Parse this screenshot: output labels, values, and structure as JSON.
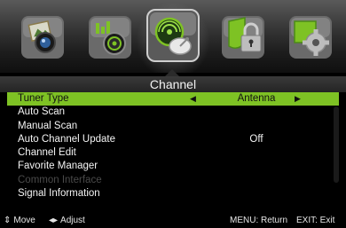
{
  "menu_title": "Channel",
  "icons": [
    {
      "name": "picture-icon"
    },
    {
      "name": "sound-icon"
    },
    {
      "name": "channel-icon"
    },
    {
      "name": "lock-icon"
    },
    {
      "name": "setup-icon"
    }
  ],
  "items": [
    {
      "label": "Tuner Type",
      "value": "Antenna",
      "state": "selected"
    },
    {
      "label": "Auto Scan",
      "value": "",
      "state": "normal"
    },
    {
      "label": "Manual Scan",
      "value": "",
      "state": "normal"
    },
    {
      "label": "Auto Channel Update",
      "value": "Off",
      "state": "normal"
    },
    {
      "label": "Channel Edit",
      "value": "",
      "state": "normal"
    },
    {
      "label": "Favorite Manager",
      "value": "",
      "state": "normal"
    },
    {
      "label": "Common Interface",
      "value": "",
      "state": "disabled"
    },
    {
      "label": "Signal Information",
      "value": "",
      "state": "normal"
    }
  ],
  "help": {
    "move_symbol": "⇕",
    "move": "Move",
    "adjust_symbol": "◂▸",
    "adjust": "Adjust",
    "menu": "MENU: Return",
    "exit": "EXIT: Exit"
  },
  "colors": {
    "selection": "#7ec224",
    "background": "#000000",
    "disabled_text": "#4a4a4a"
  }
}
